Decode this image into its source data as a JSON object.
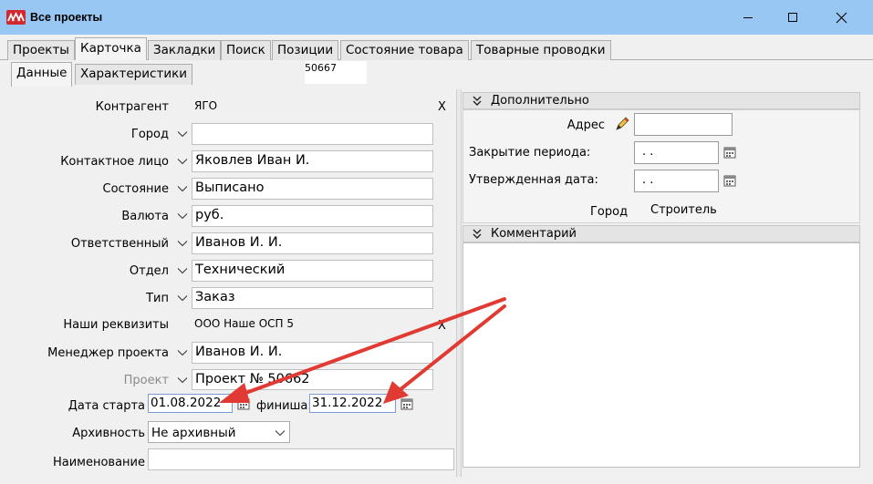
{
  "window": {
    "title": "Все проекты"
  },
  "tabs": [
    "Проекты",
    "Карточка",
    "Закладки",
    "Поиск",
    "Позиции",
    "Состояние товара",
    "Товарные проводки"
  ],
  "subtabs": [
    "Данные",
    "Характеристики"
  ],
  "project_number": "50667",
  "form": {
    "counterparty": {
      "label": "Контрагент",
      "value": "ЯГО",
      "clear": "X"
    },
    "city": {
      "label": "Город",
      "value": ""
    },
    "contact": {
      "label": "Контактное лицо",
      "value": "Яковлев Иван И."
    },
    "state": {
      "label": "Состояние",
      "value": "Выписано"
    },
    "currency": {
      "label": "Валюта",
      "value": "руб."
    },
    "responsible": {
      "label": "Ответственный",
      "value": "Иванов И. И."
    },
    "department": {
      "label": "Отдел",
      "value": "Технический"
    },
    "type": {
      "label": "Тип",
      "value": "Заказ"
    },
    "requisites": {
      "label": "Наши реквизиты",
      "value": "ООО Наше ОСП 5",
      "clear": "X"
    },
    "manager": {
      "label": "Менеджер проекта",
      "value": "Иванов И. И."
    },
    "project": {
      "label": "Проект",
      "value": "Проект № 50662"
    },
    "start_date": {
      "label": "Дата старта",
      "value": "01.08.2022"
    },
    "finish_date": {
      "label": "финиша:",
      "value": "31.12.2022"
    },
    "archive": {
      "label": "Архивность",
      "value": "Не архивный"
    },
    "name": {
      "label": "Наименование",
      "value": ""
    }
  },
  "extra": {
    "title": "Дополнительно",
    "address_label": "Адрес",
    "address_value": "",
    "period_close_label": "Закрытие периода:",
    "period_close_value": " .  .",
    "approved_date_label": "Утвержденная дата:",
    "approved_date_value": " .  .",
    "city_caption": "Город",
    "builder_caption": "Строитель"
  },
  "comment": {
    "title": "Комментарий"
  },
  "colors": {
    "titlebar": "#99c7f3",
    "arrow": "#e03a32",
    "app_icon": "#d2282e"
  }
}
